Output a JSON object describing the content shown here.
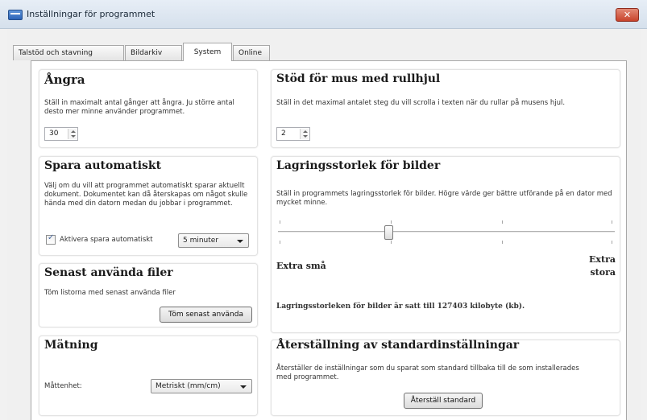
{
  "window": {
    "title": "Inställningar för programmet",
    "close_glyph": "✕"
  },
  "tabs": [
    {
      "label": "Talstöd och stavning"
    },
    {
      "label": "Bildarkiv"
    },
    {
      "label": "System",
      "active": true
    },
    {
      "label": "Online"
    }
  ],
  "undo": {
    "title": "Ångra",
    "description": "Ställ in maximalt antal gånger att ångra. Ju större antal desto mer minne använder programmet.",
    "value": "30"
  },
  "mouse_wheel": {
    "title": "Stöd för mus med rullhjul",
    "description": "Ställ in det maximal antalet steg du vill scrolla i texten när du rullar på musens hjul.",
    "value": "2"
  },
  "autosave": {
    "title": "Spara automatiskt",
    "description": "Välj om du vill att programmet automatiskt sparar aktuellt dokument. Dokumentet kan då återskapas om något skulle hända med din datorn medan du jobbar i programmet.",
    "checkbox_label": "Aktivera spara automatiskt",
    "checked": true,
    "interval": "5 minuter"
  },
  "image_storage": {
    "title": "Lagringsstorlek för bilder",
    "description": "Ställ in programmets lagringsstorlek för bilder. Högre värde ger bättre utförande på en dator med mycket minne.",
    "min_label": "Extra små",
    "max_label_line1": "Extra",
    "max_label_line2": "stora",
    "slider_level": 0.33,
    "status_text": "Lagringsstorleken för bilder är satt till  127403 kilobyte (kb)."
  },
  "recent_files": {
    "title": "Senast använda filer",
    "description": "Töm listorna med senast använda filer",
    "button": "Töm senast använda"
  },
  "measurement": {
    "title": "Mätning",
    "unit_label": "Måttenhet:",
    "unit_value": "Metriskt (mm/cm)"
  },
  "reset": {
    "title": "Återställning av standardinställningar",
    "description": "Återställer de inställningar som du sparat som standard tillbaka till de som installerades med programmet.",
    "button": "Återställ standard"
  }
}
